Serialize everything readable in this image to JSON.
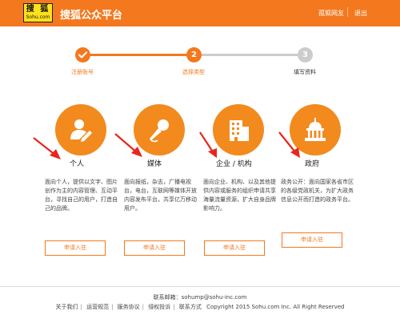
{
  "header": {
    "logo_line1": "搜 狐",
    "logo_line2": "Sohu.com",
    "title": "搜狐公众平台",
    "user": "孤狐网友",
    "logout": "退出"
  },
  "steps": [
    {
      "label": "注册账号",
      "number": "1",
      "status": "done"
    },
    {
      "label": "选择类型",
      "number": "2",
      "status": "current"
    },
    {
      "label": "填写资料",
      "number": "3",
      "status": "todo"
    }
  ],
  "cards": [
    {
      "icon": "person-icon",
      "title": "个人",
      "desc": "面向个人，提供以文字、图片创作为主的内容管理、互动平台，寻找自己的用户，打造自己的品牌。",
      "button": "申请入驻"
    },
    {
      "icon": "microphone-icon",
      "title": "媒体",
      "desc": "面向报纸，杂志，广播电视台，电台，互联网等媒体开放内容发布平台，共享亿万移动用户。",
      "button": "申请入驻"
    },
    {
      "icon": "building-icon",
      "title": "企业 / 机构",
      "desc": "面向企业、机构、以及其他提供内容或服务的组织申请共享海量流量资源，扩大自身品牌影响力。",
      "button": "申请入驻"
    },
    {
      "icon": "capitol-icon",
      "title": "政府",
      "desc": "政务公开：面向国家各省市区的各级党政机关，为扩大政务信息公开而打造的政务平台。",
      "button": "申请入驻"
    }
  ],
  "footer": {
    "email": "联系邮箱：sohump@sohu-inc.com",
    "links": [
      "关于我们",
      "运营规范",
      "服务协议",
      "侵权投诉",
      "联系方式"
    ],
    "copyright": "Copyright 2015 Sohu.com Inc. All Right Reserved"
  },
  "colors": {
    "brand": "#f4781e",
    "icon_bg": "#f28a1e",
    "step_todo": "#cccccc",
    "arrow": "#e8261c"
  }
}
